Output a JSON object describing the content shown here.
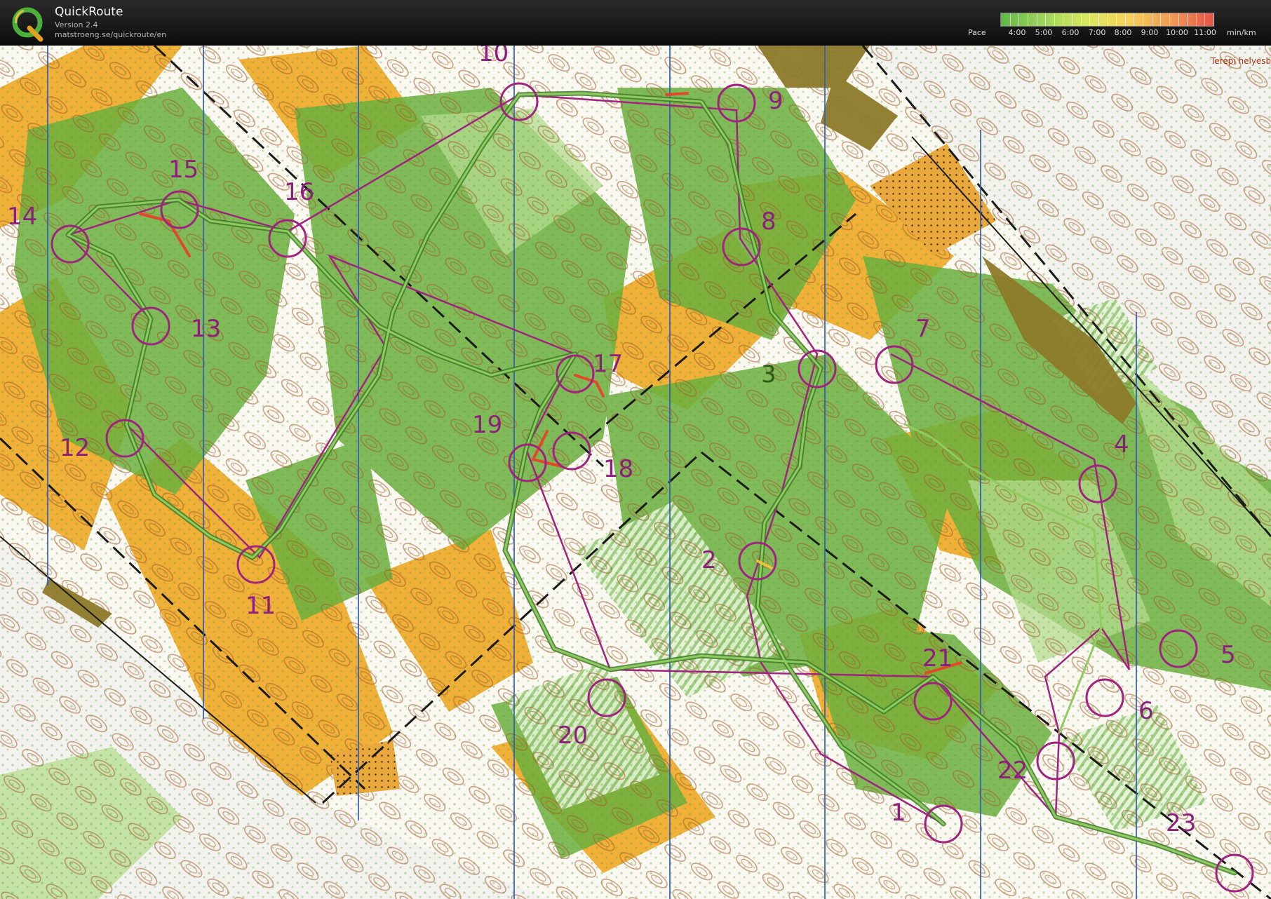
{
  "app": {
    "title": "QuickRoute",
    "version": "Version 2.4",
    "url": "matstroeng.se/quickroute/en"
  },
  "pace_legend": {
    "label": "Pace",
    "unit": "min/km",
    "ticks": [
      "4:00",
      "5:00",
      "6:00",
      "7:00",
      "8:00",
      "9:00",
      "10:00",
      "11:00"
    ],
    "gradient_colors": [
      "#5fba47",
      "#9fd45a",
      "#d8e860",
      "#f6d25a",
      "#f29a55",
      "#e8534a"
    ]
  },
  "map": {
    "corner_text": "Terepi helyesbí",
    "controls": [
      "1",
      "2",
      "3",
      "4",
      "5",
      "6",
      "7",
      "8",
      "9",
      "10",
      "11",
      "12",
      "13",
      "14",
      "15",
      "16",
      "17",
      "18",
      "19",
      "20",
      "21",
      "22",
      "23"
    ],
    "colors": {
      "open_land": "#f0a928",
      "forest": "#6bb03e",
      "course": "#a0237f",
      "grid_lines": "#2f5fb8",
      "contours": "#a6582a"
    }
  }
}
